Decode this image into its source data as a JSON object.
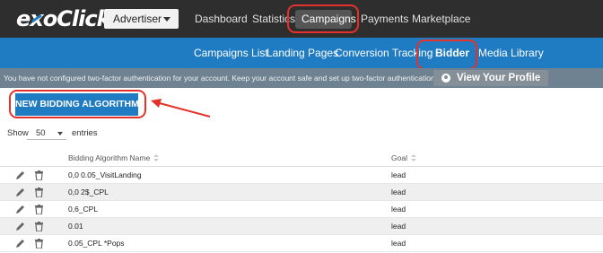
{
  "header": {
    "logo_text": "exoClick",
    "role_select_value": "Advertiser",
    "nav": [
      "Dashboard",
      "Statistics",
      "Campaigns",
      "Payments",
      "Marketplace"
    ],
    "active_nav": "Campaigns"
  },
  "subnav": {
    "items": [
      "Campaigns List",
      "Landing Pages",
      "Conversion Tracking",
      "Bidder",
      "Media Library"
    ],
    "selected": "Bidder"
  },
  "alert": {
    "message": "You have not configured two-factor authentication for your account. Keep your account safe and set up two-factor authentication now.",
    "button_label": "View Your Profile"
  },
  "actions": {
    "new_button_label": "NEW BIDDING ALGORITHM"
  },
  "table_controls": {
    "show_label": "Show",
    "page_size": "50",
    "entries_label": "entries"
  },
  "table": {
    "columns": [
      "Bidding Algorithm Name",
      "Goal"
    ],
    "rows": [
      {
        "name": "0,0 0.05_VisitLanding",
        "goal": "lead"
      },
      {
        "name": "0,0 2$_CPL",
        "goal": "lead"
      },
      {
        "name": "0,6_CPL",
        "goal": "lead"
      },
      {
        "name": "0.01",
        "goal": "lead"
      },
      {
        "name": "0.05_CPL *Pops",
        "goal": "lead"
      }
    ]
  },
  "colors": {
    "topbar": "#2e2e2e",
    "brand_blue": "#1f7bc2",
    "alert_bar": "#6f8291",
    "annotation_red": "#e5312b"
  },
  "icons": [
    "pencil-icon",
    "trash-icon",
    "user-circle-icon",
    "chevron-down-icon",
    "sort-icon"
  ]
}
